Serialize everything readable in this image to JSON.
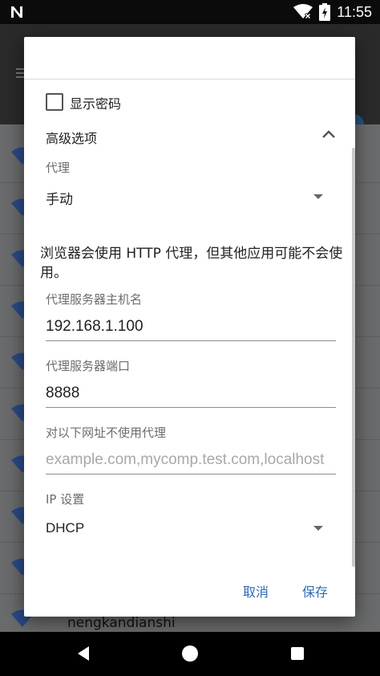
{
  "status_bar": {
    "time": "11:55",
    "icons": [
      "notification-n-icon",
      "wifi-no-internet-icon",
      "battery-charging-icon"
    ]
  },
  "background": {
    "partial_row_label": "nengkandianshi",
    "row_icon": "wifi-signal-icon"
  },
  "dialog": {
    "show_password_label": "显示密码",
    "show_password_checked": false,
    "advanced_options_label": "高级选项",
    "advanced_icon": "chevron-up-icon",
    "proxy": {
      "label": "代理",
      "value": "手动"
    },
    "proxy_warning": "浏览器会使用 HTTP 代理，但其他应用可能不会使用。",
    "proxy_hostname": {
      "label": "代理服务器主机名",
      "value": "192.168.1.100"
    },
    "proxy_port": {
      "label": "代理服务器端口",
      "value": "8888"
    },
    "bypass": {
      "label": "对以下网址不使用代理",
      "placeholder": "example.com,mycomp.test.com,localhost"
    },
    "ip_settings": {
      "label": "IP 设置",
      "value": "DHCP"
    },
    "cancel_label": "取消",
    "save_label": "保存"
  },
  "nav_bar": {
    "icons": [
      "back-icon",
      "home-icon",
      "recents-icon"
    ]
  },
  "colors": {
    "accent": "#2f6bb2",
    "status_bar": "#0b0b0b",
    "scrim": "#5f6062"
  }
}
